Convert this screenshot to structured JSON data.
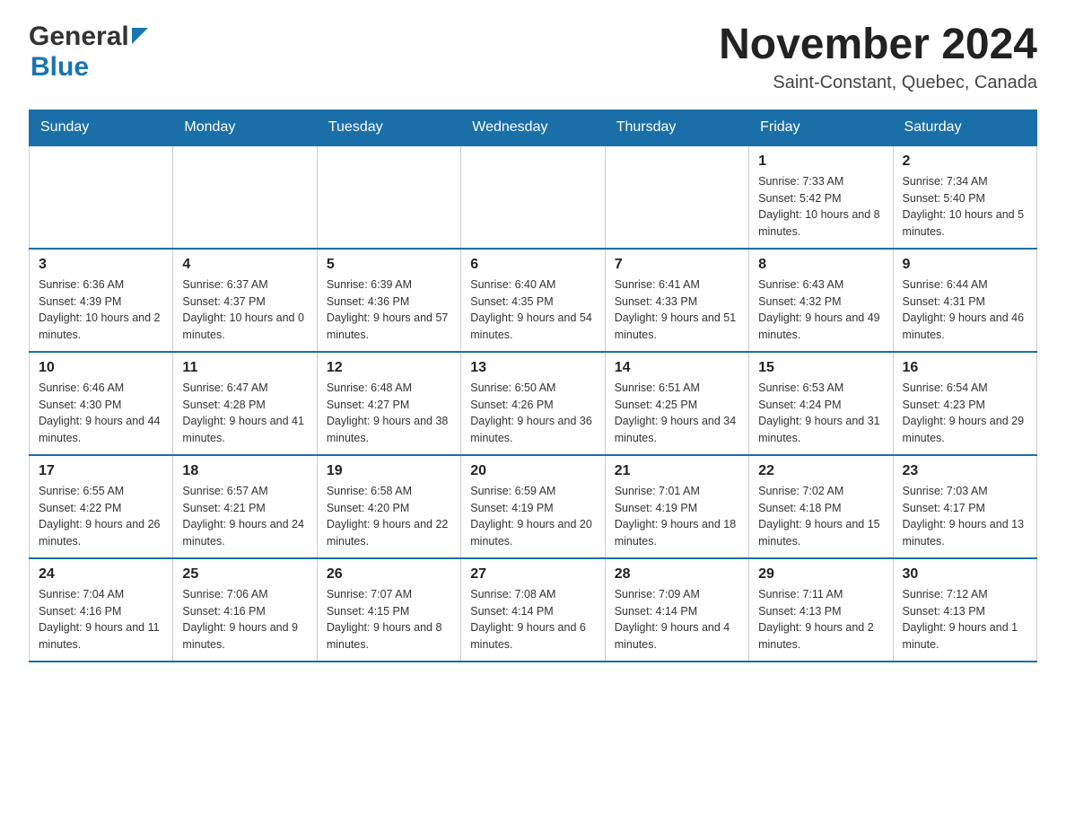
{
  "header": {
    "logo_general": "General",
    "logo_blue": "Blue",
    "month_title": "November 2024",
    "location": "Saint-Constant, Quebec, Canada"
  },
  "weekdays": [
    "Sunday",
    "Monday",
    "Tuesday",
    "Wednesday",
    "Thursday",
    "Friday",
    "Saturday"
  ],
  "weeks": [
    [
      {
        "day": "",
        "info": ""
      },
      {
        "day": "",
        "info": ""
      },
      {
        "day": "",
        "info": ""
      },
      {
        "day": "",
        "info": ""
      },
      {
        "day": "",
        "info": ""
      },
      {
        "day": "1",
        "info": "Sunrise: 7:33 AM\nSunset: 5:42 PM\nDaylight: 10 hours and 8 minutes."
      },
      {
        "day": "2",
        "info": "Sunrise: 7:34 AM\nSunset: 5:40 PM\nDaylight: 10 hours and 5 minutes."
      }
    ],
    [
      {
        "day": "3",
        "info": "Sunrise: 6:36 AM\nSunset: 4:39 PM\nDaylight: 10 hours and 2 minutes."
      },
      {
        "day": "4",
        "info": "Sunrise: 6:37 AM\nSunset: 4:37 PM\nDaylight: 10 hours and 0 minutes."
      },
      {
        "day": "5",
        "info": "Sunrise: 6:39 AM\nSunset: 4:36 PM\nDaylight: 9 hours and 57 minutes."
      },
      {
        "day": "6",
        "info": "Sunrise: 6:40 AM\nSunset: 4:35 PM\nDaylight: 9 hours and 54 minutes."
      },
      {
        "day": "7",
        "info": "Sunrise: 6:41 AM\nSunset: 4:33 PM\nDaylight: 9 hours and 51 minutes."
      },
      {
        "day": "8",
        "info": "Sunrise: 6:43 AM\nSunset: 4:32 PM\nDaylight: 9 hours and 49 minutes."
      },
      {
        "day": "9",
        "info": "Sunrise: 6:44 AM\nSunset: 4:31 PM\nDaylight: 9 hours and 46 minutes."
      }
    ],
    [
      {
        "day": "10",
        "info": "Sunrise: 6:46 AM\nSunset: 4:30 PM\nDaylight: 9 hours and 44 minutes."
      },
      {
        "day": "11",
        "info": "Sunrise: 6:47 AM\nSunset: 4:28 PM\nDaylight: 9 hours and 41 minutes."
      },
      {
        "day": "12",
        "info": "Sunrise: 6:48 AM\nSunset: 4:27 PM\nDaylight: 9 hours and 38 minutes."
      },
      {
        "day": "13",
        "info": "Sunrise: 6:50 AM\nSunset: 4:26 PM\nDaylight: 9 hours and 36 minutes."
      },
      {
        "day": "14",
        "info": "Sunrise: 6:51 AM\nSunset: 4:25 PM\nDaylight: 9 hours and 34 minutes."
      },
      {
        "day": "15",
        "info": "Sunrise: 6:53 AM\nSunset: 4:24 PM\nDaylight: 9 hours and 31 minutes."
      },
      {
        "day": "16",
        "info": "Sunrise: 6:54 AM\nSunset: 4:23 PM\nDaylight: 9 hours and 29 minutes."
      }
    ],
    [
      {
        "day": "17",
        "info": "Sunrise: 6:55 AM\nSunset: 4:22 PM\nDaylight: 9 hours and 26 minutes."
      },
      {
        "day": "18",
        "info": "Sunrise: 6:57 AM\nSunset: 4:21 PM\nDaylight: 9 hours and 24 minutes."
      },
      {
        "day": "19",
        "info": "Sunrise: 6:58 AM\nSunset: 4:20 PM\nDaylight: 9 hours and 22 minutes."
      },
      {
        "day": "20",
        "info": "Sunrise: 6:59 AM\nSunset: 4:19 PM\nDaylight: 9 hours and 20 minutes."
      },
      {
        "day": "21",
        "info": "Sunrise: 7:01 AM\nSunset: 4:19 PM\nDaylight: 9 hours and 18 minutes."
      },
      {
        "day": "22",
        "info": "Sunrise: 7:02 AM\nSunset: 4:18 PM\nDaylight: 9 hours and 15 minutes."
      },
      {
        "day": "23",
        "info": "Sunrise: 7:03 AM\nSunset: 4:17 PM\nDaylight: 9 hours and 13 minutes."
      }
    ],
    [
      {
        "day": "24",
        "info": "Sunrise: 7:04 AM\nSunset: 4:16 PM\nDaylight: 9 hours and 11 minutes."
      },
      {
        "day": "25",
        "info": "Sunrise: 7:06 AM\nSunset: 4:16 PM\nDaylight: 9 hours and 9 minutes."
      },
      {
        "day": "26",
        "info": "Sunrise: 7:07 AM\nSunset: 4:15 PM\nDaylight: 9 hours and 8 minutes."
      },
      {
        "day": "27",
        "info": "Sunrise: 7:08 AM\nSunset: 4:14 PM\nDaylight: 9 hours and 6 minutes."
      },
      {
        "day": "28",
        "info": "Sunrise: 7:09 AM\nSunset: 4:14 PM\nDaylight: 9 hours and 4 minutes."
      },
      {
        "day": "29",
        "info": "Sunrise: 7:11 AM\nSunset: 4:13 PM\nDaylight: 9 hours and 2 minutes."
      },
      {
        "day": "30",
        "info": "Sunrise: 7:12 AM\nSunset: 4:13 PM\nDaylight: 9 hours and 1 minute."
      }
    ]
  ]
}
